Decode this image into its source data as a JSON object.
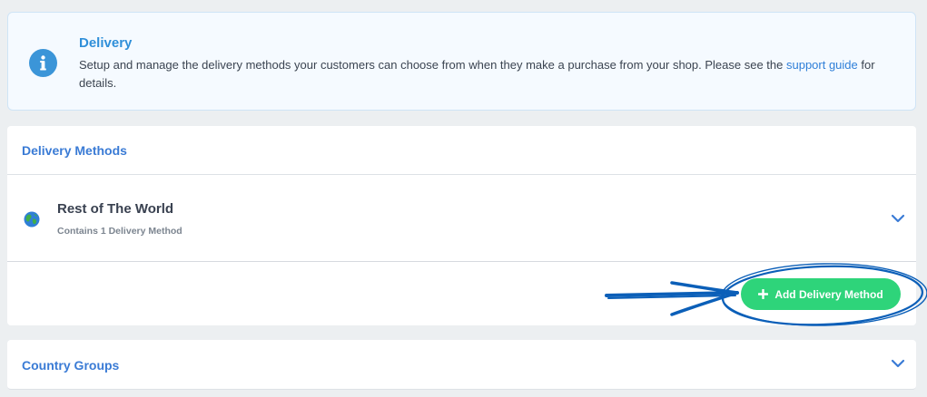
{
  "info": {
    "title": "Delivery",
    "text_before_link": "Setup and manage the delivery methods your customers can choose from when they make a purchase from your shop. Please see the ",
    "link_text": "support guide",
    "text_after_link": " for details.",
    "icon": "info-icon"
  },
  "delivery_methods": {
    "title": "Delivery Methods",
    "items": [
      {
        "name": "Rest of The World",
        "subtitle": "Contains 1 Delivery Method",
        "icon": "globe-icon"
      }
    ],
    "add_button_label": "Add Delivery Method"
  },
  "country_groups": {
    "title": "Country Groups"
  },
  "colors": {
    "accent_blue": "#3a7bd5",
    "info_blue": "#3b95d8",
    "button_green": "#2ed47a",
    "annotation_blue": "#0b5fb8"
  }
}
